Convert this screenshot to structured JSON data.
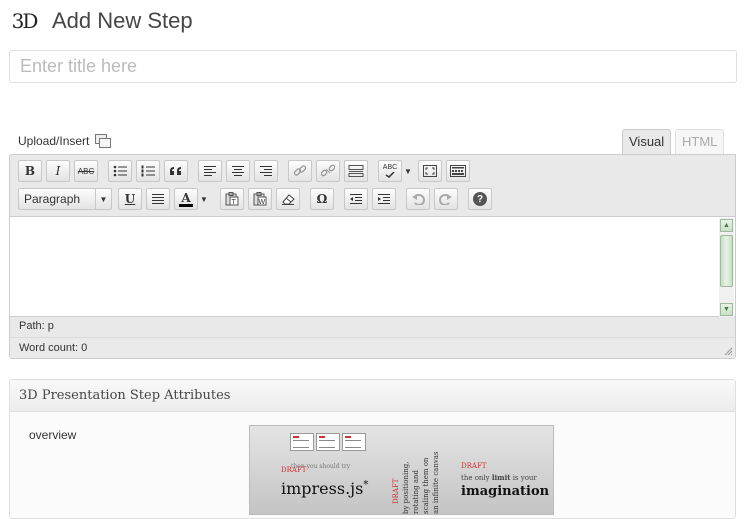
{
  "header": {
    "logo_text": "3D",
    "title": "Add New Step"
  },
  "title_input": {
    "placeholder": "Enter title here",
    "value": ""
  },
  "upload": {
    "label": "Upload/Insert"
  },
  "tabs": [
    {
      "label": "Visual",
      "active": true
    },
    {
      "label": "HTML",
      "active": false
    }
  ],
  "toolbar": {
    "row1": [
      "bold-icon",
      "italic-icon",
      "strikethrough-icon",
      "unordered-list-icon",
      "ordered-list-icon",
      "blockquote-icon",
      "align-left-icon",
      "align-center-icon",
      "align-right-icon",
      "link-icon",
      "unlink-icon",
      "more-tag-icon",
      "spellcheck-icon",
      "fullscreen-icon",
      "kitchen-sink-icon"
    ],
    "bold_glyph": "B",
    "italic_glyph": "I",
    "strike_glyph": "ABC",
    "spell_glyph": "ABC",
    "format_select": "Paragraph",
    "underline_glyph": "U",
    "text_color_glyph": "A",
    "special_char_glyph": "Ω",
    "help_glyph": "?"
  },
  "editor": {
    "content": "",
    "path_label": "Path:",
    "path_value": "p",
    "word_count_label": "Word count:",
    "word_count": "0"
  },
  "metabox": {
    "title": "3D Presentation Step Attributes",
    "field_label": "overview",
    "preview": {
      "then": "then you should try",
      "draft": "DRAFT",
      "impress": "impress.js",
      "asterisk": "*",
      "vertical_1": "by positioning,",
      "vertical_2": "rotating and",
      "vertical_3": "scaling them on",
      "vertical_4": "an infinite canvas",
      "tagline_pre": "the only ",
      "tagline_bold": "limit",
      "tagline_post": " is your",
      "imagination": "imagination"
    }
  },
  "colors": {
    "accent_red": "#cc3333",
    "scroll_green": "#c7dfc4"
  }
}
